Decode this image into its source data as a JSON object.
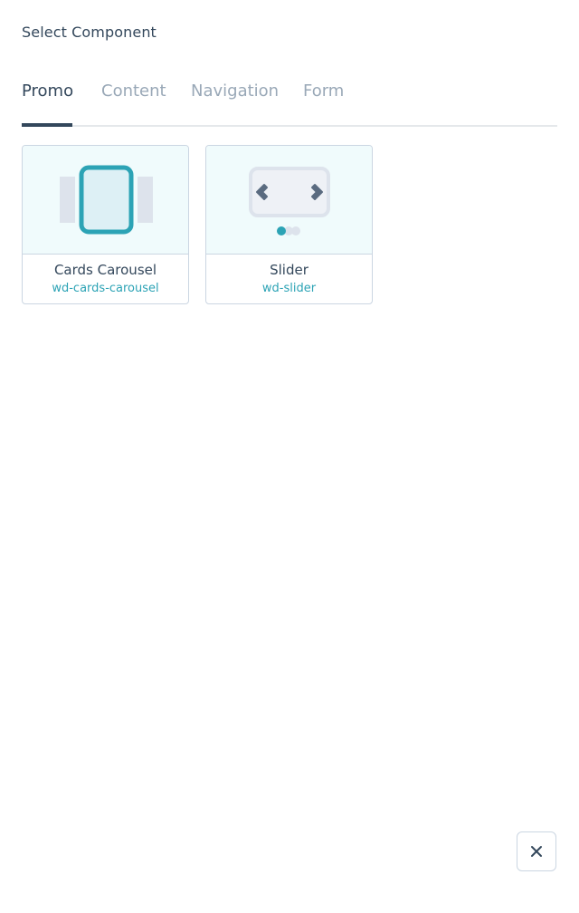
{
  "header": {
    "title": "Select Component"
  },
  "tabs": [
    {
      "label": "Promo",
      "active": true
    },
    {
      "label": "Content",
      "active": false
    },
    {
      "label": "Navigation",
      "active": false
    },
    {
      "label": "Form",
      "active": false
    }
  ],
  "components": [
    {
      "title": "Cards Carousel",
      "id": "wd-cards-carousel",
      "icon": "cards-carousel-icon"
    },
    {
      "title": "Slider",
      "id": "wd-slider",
      "icon": "slider-icon"
    }
  ],
  "footer": {
    "close_icon": "close-icon"
  },
  "colors": {
    "text": "#33475b",
    "muted": "#99a8b7",
    "accent": "#2ca3b5",
    "border": "#cbd6e2",
    "preview_bg": "#f0fbfc"
  }
}
